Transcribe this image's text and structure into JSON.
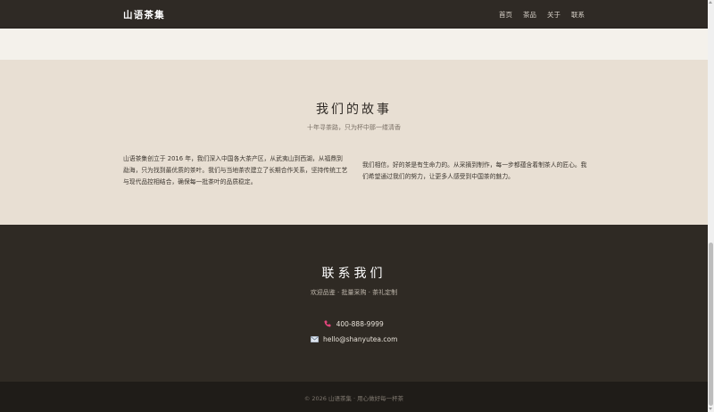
{
  "nav": {
    "brand": "山语茶集",
    "links": [
      "首页",
      "茶品",
      "关于",
      "联系"
    ]
  },
  "story": {
    "title": "我们的故事",
    "subtitle": "十年寻茶路，只为杯中那一缕清香",
    "paragraph_left": "山语茶集创立于 2016 年，我们深入中国各大茶产区，从武夷山到西湖，从福鼎到勐海，只为找到最优质的茶叶。我们与当地茶农建立了长期合作关系，坚持传统工艺与现代品控相结合，确保每一批茶叶的品质稳定。",
    "paragraph_right": "我们相信，好的茶是有生命力的。从采摘到制作，每一步都蕴含着制茶人的匠心。我们希望通过我们的努力，让更多人感受到中国茶的魅力。"
  },
  "contact": {
    "title": "联系我们",
    "subtitle": "欢迎品鉴 · 批量采购 · 茶礼定制",
    "phone": "400-888-9999",
    "email": "hello@shanyutea.com",
    "phone_icon": "phone-icon",
    "email_icon": "envelope-icon"
  },
  "footer": {
    "text": "© 2026 山语茶集 · 用心做好每一杯茶"
  },
  "colors": {
    "nav_bg": "#2f2a25",
    "story_bg": "#e8dfd3",
    "contact_bg": "#2f2a24",
    "footer_bg": "#1f1c18",
    "phone_icon_color": "#e0457b"
  }
}
